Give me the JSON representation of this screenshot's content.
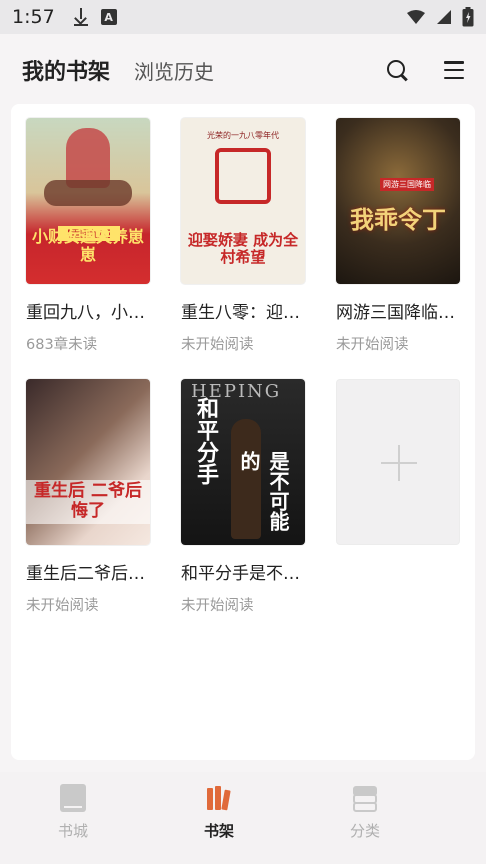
{
  "status_bar": {
    "time": "1:57",
    "icons": [
      "download-icon",
      "a-app-icon",
      "wifi-icon",
      "signal-icon",
      "battery-icon"
    ]
  },
  "header": {
    "active_tab": "我的书架",
    "inactive_tab": "浏览历史",
    "search_icon": "search-icon",
    "menu_icon": "menu-icon"
  },
  "books": [
    {
      "title": "重回九八，小…",
      "status": "683章未读",
      "cover_text": "小财女追夫养崽崽",
      "cover_tag": "【重回九八】"
    },
    {
      "title": "重生八零：迎…",
      "status": "未开始阅读",
      "cover_text": "迎娶娇妻 成为全村希望",
      "cover_top": "光荣的一九八零年代"
    },
    {
      "title": "网游三国降临…",
      "status": "未开始阅读",
      "cover_text": "我乖令丁",
      "cover_tag": "网游三国降临"
    },
    {
      "title": "重生后二爷后…",
      "status": "未开始阅读",
      "cover_text": "重生后 二爷后悔了"
    },
    {
      "title": "和平分手是不…",
      "status": "未开始阅读",
      "cover_text_a": "和平分手",
      "cover_text_b": "是不可能的",
      "cover_top": "HEPING"
    }
  ],
  "add_book": {
    "icon": "plus-icon"
  },
  "bottom_nav": [
    {
      "label": "书城",
      "icon": "book-icon",
      "active": false
    },
    {
      "label": "书架",
      "icon": "bookshelf-icon",
      "active": true
    },
    {
      "label": "分类",
      "icon": "layers-icon",
      "active": false
    }
  ],
  "colors": {
    "accent": "#e06a3a",
    "background": "#f6f4f5",
    "card": "#ffffff",
    "muted_text": "#9a9a9a"
  }
}
